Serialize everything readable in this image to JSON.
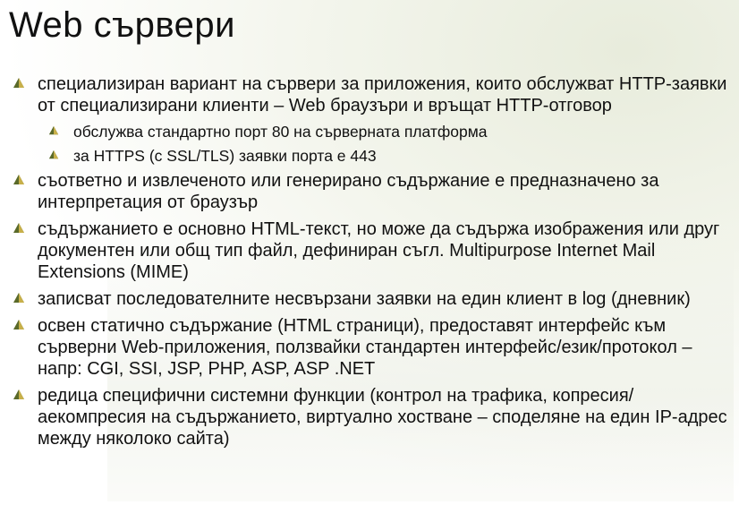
{
  "slide": {
    "title": "Web сървери",
    "bullets": [
      "специализиран вариант на сървери за приложения, които обслужват HTTP-заявки от специализирани клиенти – Web браузъри и връщат HTTP-отговор",
      "обслужва стандартно порт 80 на сърверната платформа",
      "за HTTPS (с SSL/TLS) заявки порта е 443",
      "съответно и извлеченото или генерирано съдържание е предназначено за интерпретация от браузър",
      "съдържанието е основно HTML-текст, но може да съдържа изображения или друг документен или общ тип файл, дефиниран съгл. Multipurpose Internet Mail Extensions (MIME)",
      "записват последователните несвързани заявки на един клиент в log (дневник)",
      "освен статично съдържание (HTML страници), предоставят интерфейс към сърверни Web-приложения, ползвайки стандартен интерфейс/език/протокол – напр: CGI, SSI, JSP, PHP, ASP, ASP .NET",
      "редица специфични системни функции (контрол на трафика, копресия/аекомпресия на съдържанието, виртуално хостване – споделяне на един IP-адрес между няколоко сайта)"
    ]
  },
  "colors": {
    "bullet": "#5a6a2a",
    "bullet_highlight": "#c8b04a",
    "text": "#111111"
  },
  "icons": {
    "bullet": "pyramid-bullet-icon"
  }
}
